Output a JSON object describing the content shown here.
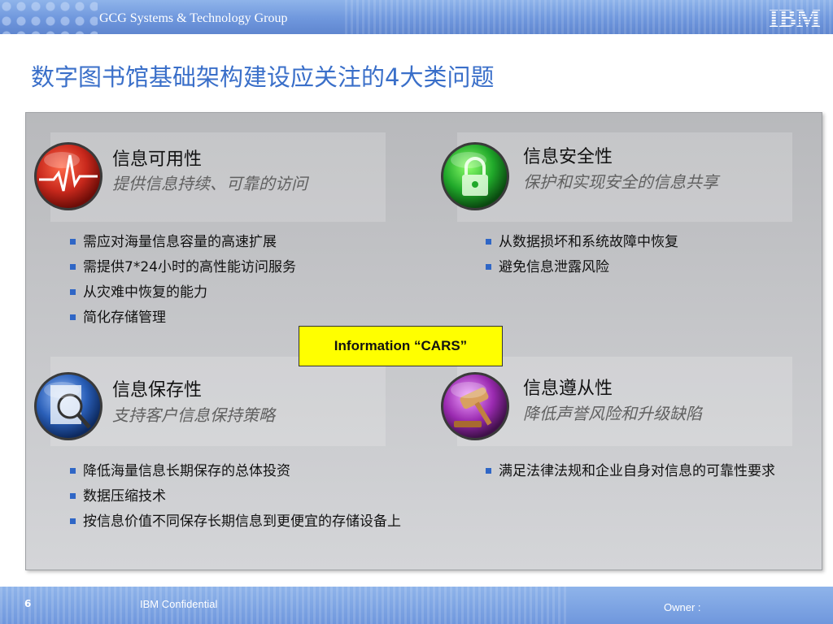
{
  "header": {
    "group_name": "GCG Systems & Technology Group",
    "logo_text": "IBM"
  },
  "slide": {
    "title": "数字图书馆基础架构建设应关注的4大类问题"
  },
  "quadrants": [
    {
      "title": "信息可用性",
      "subtitle": "提供信息持续、可靠的访问",
      "icon": "heartbeat-data-icon",
      "bullets": [
        "需应对海量信息容量的高速扩展",
        "需提供7*24小时的高性能访问服务",
        "从灾难中恢复的能力",
        "简化存储管理"
      ]
    },
    {
      "title": "信息安全性",
      "subtitle": "保护和实现安全的信息共享",
      "icon": "lock-icon",
      "bullets": [
        "从数据损坏和系统故障中恢复",
        "避免信息泄露风险"
      ]
    },
    {
      "title": "信息保存性",
      "subtitle": "支持客户信息保持策略",
      "icon": "magnifier-document-icon",
      "bullets": [
        "降低海量信息长期保存的总体投资",
        "数据压缩技术",
        "按信息价值不同保存长期信息到更便宜的存储设备上"
      ]
    },
    {
      "title": "信息遵从性",
      "subtitle": "降低声誉风险和升级缺陷",
      "icon": "gavel-icon",
      "bullets": [
        "满足法律法规和企业自身对信息的可靠性要求"
      ]
    }
  ],
  "center_label": "Information “CARS”",
  "footer": {
    "page_number": "6",
    "confidential": "IBM Confidential",
    "owner": "Owner :"
  },
  "colors": {
    "title": "#3a6fc9",
    "bullet": "#2f66c6",
    "highlight": "#ffff00"
  }
}
